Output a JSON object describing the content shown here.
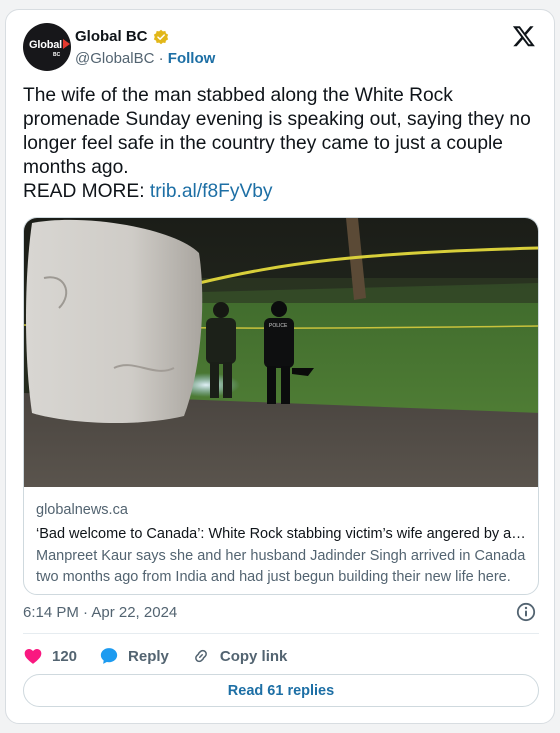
{
  "account": {
    "name": "Global BC",
    "handle": "@GlobalBC",
    "separator": "·",
    "follow_label": "Follow",
    "avatar_text": "Global",
    "avatar_subtext": "BC"
  },
  "tweet": {
    "text": "The wife of the man stabbed along the White Rock promenade Sunday evening is speaking out, saying they no longer feel safe in the country they came to just a couple months ago.",
    "read_more_prefix": "READ MORE: ",
    "link_text": "trib.al/f8FyVby"
  },
  "link_card": {
    "domain": "globalnews.ca",
    "headline": "‘Bad welcome to Canada’: White Rock stabbing victim’s wife angered by attack",
    "description": "Manpreet Kaur says she and her husband Jadinder Singh arrived in Canada two months ago from India and had just begun building their new life here.",
    "image_signs": [
      "POLICE"
    ]
  },
  "meta": {
    "timestamp": "6:14 PM · Apr 22, 2024"
  },
  "actions": {
    "likes": "120",
    "reply_label": "Reply",
    "copy_label": "Copy link"
  },
  "replies_button": "Read 61 replies",
  "icons": [
    "x-logo-icon",
    "verified-badge-icon",
    "info-icon",
    "heart-icon",
    "reply-bubble-icon",
    "link-icon"
  ],
  "colors": {
    "link_blue": "#1d6fa5",
    "heart_pink": "#f91880",
    "reply_blue": "#1d9bf0",
    "verified_gold": "#e2b719",
    "secondary_text": "#536471"
  }
}
